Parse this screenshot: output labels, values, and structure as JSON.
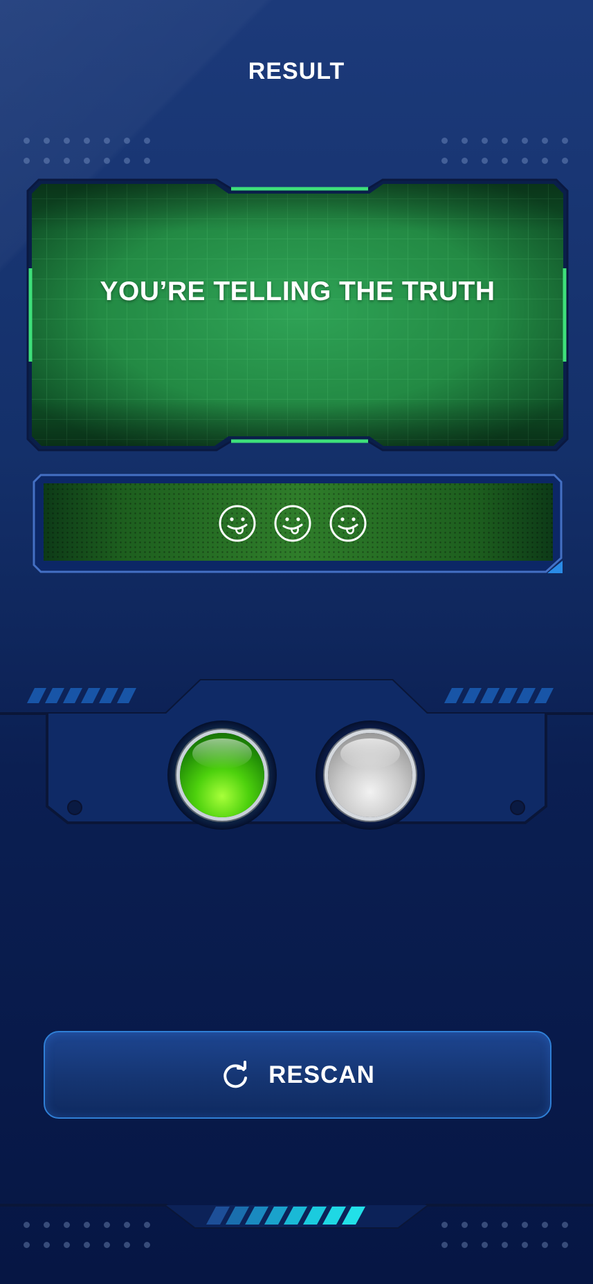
{
  "header": {
    "title": "RESULT"
  },
  "result": {
    "message": "YOU’RE TELLING THE TRUTH"
  },
  "indicators": {
    "faces": [
      "tongue-out-face-icon",
      "tongue-out-face-icon",
      "tongue-out-face-icon"
    ],
    "lights": [
      {
        "name": "truth-light",
        "state": "on",
        "color": "#5bd616"
      },
      {
        "name": "lie-light",
        "state": "off",
        "color": "#c8c8c8"
      }
    ]
  },
  "actions": {
    "rescan_label": "RESCAN",
    "rescan_icon": "refresh-icon"
  },
  "colors": {
    "background": "#14306a",
    "result_panel": "#1f8a3e",
    "accent_green": "#3ad36a",
    "accent_blue": "#2f7fd6",
    "footer_stripes": "#1fd0e0"
  }
}
